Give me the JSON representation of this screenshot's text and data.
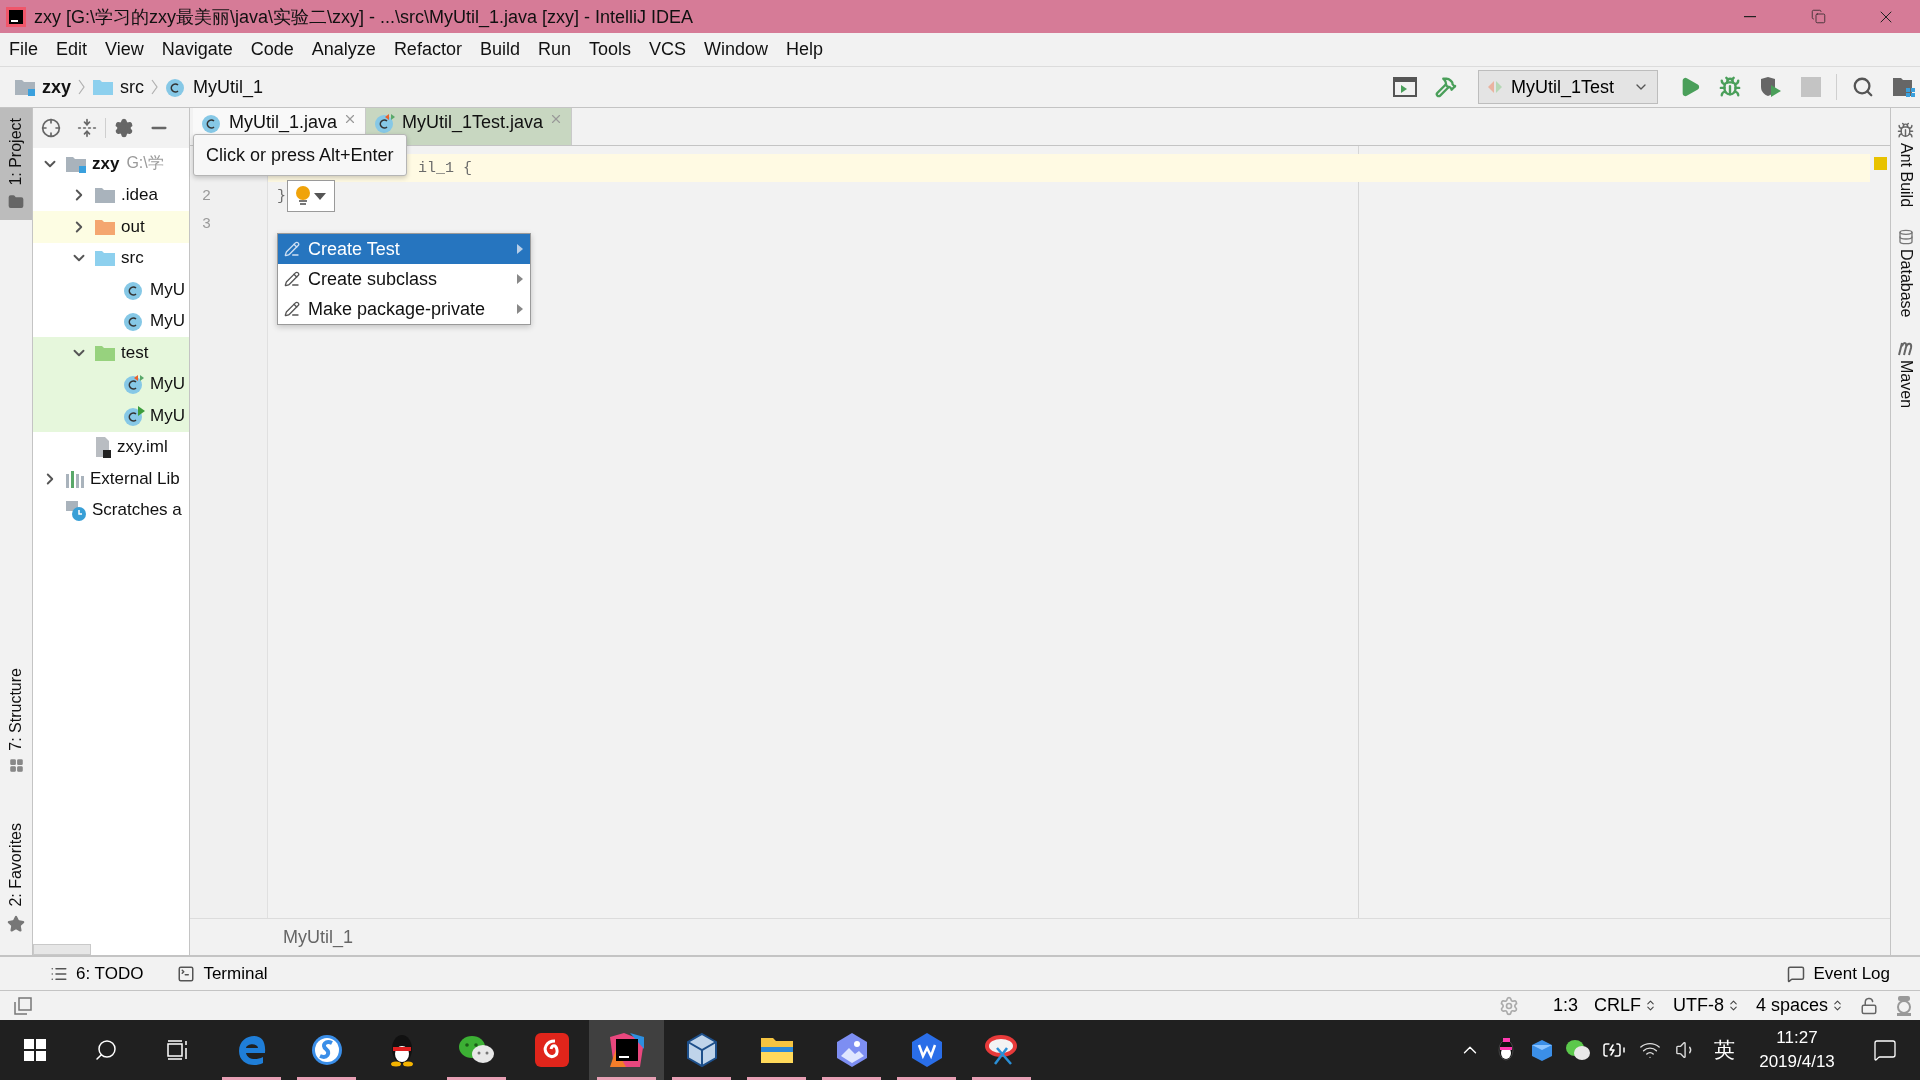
{
  "window": {
    "title": "zxy [G:\\学习的zxy最美丽\\java\\实验二\\zxy] - ...\\src\\MyUtil_1.java [zxy] - IntelliJ IDEA"
  },
  "menu": [
    "File",
    "Edit",
    "View",
    "Navigate",
    "Code",
    "Analyze",
    "Refactor",
    "Build",
    "Run",
    "Tools",
    "VCS",
    "Window",
    "Help"
  ],
  "breadcrumbs": [
    {
      "label": "zxy",
      "kind": "module"
    },
    {
      "label": "src",
      "kind": "folder"
    },
    {
      "label": "MyUtil_1",
      "kind": "class"
    }
  ],
  "toolbar": {
    "run_config": "MyUtil_1Test",
    "stop_disabled": true
  },
  "left_stripe": [
    {
      "label": "1: Project",
      "selected": true,
      "kind": "project"
    },
    {
      "label": "7: Structure",
      "selected": false,
      "kind": "structure"
    },
    {
      "label": "2: Favorites",
      "selected": false,
      "kind": "favorites"
    }
  ],
  "right_stripe": [
    {
      "label": "Ant Build",
      "kind": "ant"
    },
    {
      "label": "Database",
      "kind": "database"
    },
    {
      "label": "Maven",
      "kind": "maven"
    }
  ],
  "project_tree": [
    {
      "label": "zxy",
      "path": "G:\\学",
      "kind": "module",
      "expanded": true,
      "excluded": false,
      "test_source": false,
      "children": [
        {
          "label": ".idea",
          "kind": "folder",
          "color": "#a9b3bc",
          "expanded": false,
          "excluded": false,
          "test_source": false
        },
        {
          "label": "out",
          "kind": "folder",
          "color": "#f4a670",
          "expanded": false,
          "excluded": true,
          "test_source": false
        },
        {
          "label": "src",
          "kind": "folder",
          "color": "#8dd0ee",
          "expanded": true,
          "excluded": false,
          "test_source": false,
          "children": [
            {
              "label": "MyU",
              "kind": "class",
              "excluded": false,
              "test_source": false
            },
            {
              "label": "MyU",
              "kind": "class",
              "excluded": false,
              "test_source": false
            }
          ]
        },
        {
          "label": "test",
          "kind": "folder",
          "color": "#97d27e",
          "expanded": true,
          "excluded": false,
          "test_source": true,
          "children": [
            {
              "label": "MyU",
              "kind": "test_class",
              "excluded": false,
              "test_source": true
            },
            {
              "label": "MyU",
              "kind": "run_class",
              "excluded": false,
              "test_source": true
            }
          ]
        },
        {
          "label": "zxy.iml",
          "kind": "file",
          "excluded": false,
          "test_source": false
        }
      ]
    },
    {
      "label": "External Lib",
      "kind": "library",
      "expanded": false,
      "excluded": false,
      "test_source": false
    },
    {
      "label": "Scratches a",
      "kind": "scratches",
      "excluded": false,
      "test_source": false
    }
  ],
  "tabs": [
    {
      "label": "MyUtil_1.java",
      "kind": "class",
      "selected": true
    },
    {
      "label": "MyUtil_1Test.java",
      "kind": "test",
      "selected": false
    }
  ],
  "editor": {
    "lines": [
      {
        "code": "il_1 {",
        "current": true
      },
      {
        "number": "2",
        "code": "}",
        "current": false
      },
      {
        "number": "3",
        "current": false
      }
    ],
    "tooltip": "Click or press Alt+Enter",
    "intention_menu": [
      {
        "label": "Create Test",
        "selected": true
      },
      {
        "label": "Create subclass",
        "selected": false
      },
      {
        "label": "Make package-private",
        "selected": false
      }
    ],
    "breadcrumb": "MyUtil_1"
  },
  "tool_windows": [
    {
      "label": "6: TODO",
      "kind": "todo"
    },
    {
      "label": "Terminal",
      "kind": "terminal"
    }
  ],
  "event_log": "Event Log",
  "status": {
    "position": "1:3",
    "line_separator": "CRLF",
    "encoding": "UTF-8",
    "indent": "4 spaces"
  },
  "taskbar": {
    "apps": [
      {
        "kind": "edge",
        "running": true,
        "active": false
      },
      {
        "kind": "sogou",
        "running": true,
        "active": false
      },
      {
        "kind": "qq",
        "running": false,
        "active": false
      },
      {
        "kind": "wechat",
        "running": true,
        "active": false
      },
      {
        "kind": "music",
        "running": false,
        "active": false
      },
      {
        "kind": "idea",
        "running": true,
        "active": true
      },
      {
        "kind": "vbox",
        "running": true,
        "active": false
      },
      {
        "kind": "explorer",
        "running": true,
        "active": false
      },
      {
        "kind": "photos",
        "running": true,
        "active": false
      },
      {
        "kind": "wps",
        "running": true,
        "active": false
      },
      {
        "kind": "paint",
        "running": true,
        "active": false
      }
    ],
    "language": "英",
    "time": "11:27",
    "date": "2019/4/13"
  }
}
